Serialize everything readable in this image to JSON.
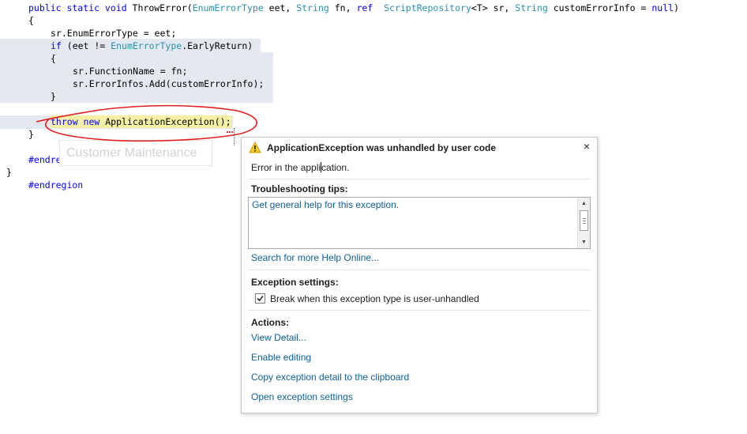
{
  "code": {
    "line1": {
      "kw1": "public static void",
      "name": " ThrowError(",
      "t1": "EnumErrorType",
      "p1": " eet, ",
      "t2": "String",
      "p2": " fn, ",
      "kw2": "ref",
      "sp": "  ",
      "t3": "ScriptRepository",
      "p3": "<T> sr, ",
      "t4": "String",
      "p4": " customErrorInfo = ",
      "kw3": "null",
      "end": ")"
    },
    "line2": "{",
    "line3": "sr.EnumErrorType = eet;",
    "line4": {
      "kw": "if",
      "a": " (eet != ",
      "t": "EnumErrorType",
      "b": ".EarlyReturn)"
    },
    "line5": "{",
    "line6": "sr.FunctionName = fn;",
    "line7": "sr.ErrorInfos.Add(customErrorInfo);",
    "line8": "}",
    "line9": {
      "kw": "throw new",
      "a": " ApplicationException",
      "b": "();"
    },
    "line10": "}",
    "line11": "#endregion",
    "line12": "}",
    "line13": "#endregion"
  },
  "ghost_text": "Customer Maintenance",
  "popup": {
    "title": "ApplicationException was unhandled by user code",
    "close": "×",
    "message_a": "Error in the appli",
    "message_b": "cation.",
    "tips_header": "Troubleshooting tips:",
    "tips_link": "Get general help for this exception.",
    "search_link": "Search for more Help Online...",
    "settings_header": "Exception settings:",
    "checkbox_label": "Break when this exception type is user-unhandled",
    "checkbox_mark": "✓",
    "actions_header": "Actions:",
    "actions": [
      "View Detail...",
      "Enable editing",
      "Copy exception detail to the clipboard",
      "Open exception settings"
    ]
  },
  "icons": {
    "warning": "warning-icon",
    "close": "close-icon",
    "checkbox": "checkbox"
  },
  "colors": {
    "keyword": "#0000ff",
    "type": "#2b91af",
    "link": "#0e6198",
    "highlight": "#f4f0a4",
    "annotation": "#e02020"
  }
}
